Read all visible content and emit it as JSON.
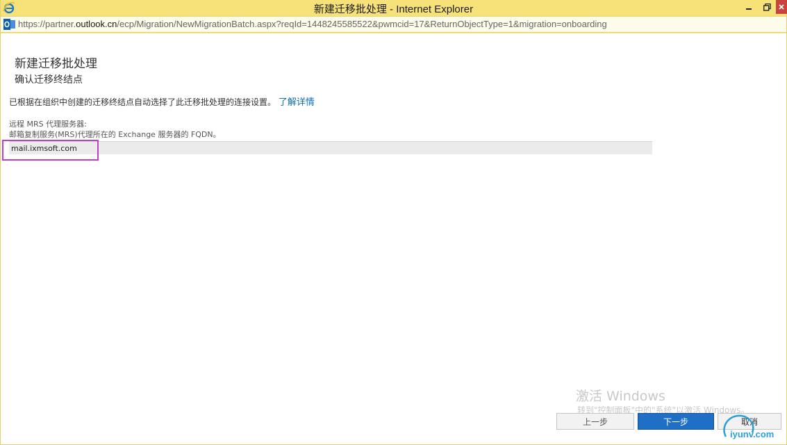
{
  "window": {
    "title": "新建迁移批处理 - Internet Explorer",
    "url_prefix": "https://partner.",
    "url_host": "outlook.cn",
    "url_suffix": "/ecp/Migration/NewMigrationBatch.aspx?reqId=1448245585522&pwmcid=17&ReturnObjectType=1&migration=onboarding"
  },
  "page": {
    "title": "新建迁移批处理",
    "subtitle": "确认迁移终结点",
    "info_text": "已根据在组织中创建的迁移终结点自动选择了此迁移批处理的连接设置。",
    "learn_more": "了解详情"
  },
  "field": {
    "label": "远程 MRS 代理服务器:",
    "description": "邮箱复制服务(MRS)代理所在的 Exchange 服务器的 FQDN。",
    "value": "mail.ixmsoft.com"
  },
  "watermark": {
    "title": "激活 Windows",
    "subtitle": "转到\"控制面板\"中的\"系统\"以激活 Windows。"
  },
  "buttons": {
    "prev": "上一步",
    "next": "下一步",
    "cancel": "取消"
  },
  "site_logo": {
    "text": "iyunv.com"
  },
  "colors": {
    "titlebar": "#f7e27a",
    "highlight": "#c03fca",
    "primary_button": "#1e6fc5",
    "link": "#0a6fb4"
  }
}
